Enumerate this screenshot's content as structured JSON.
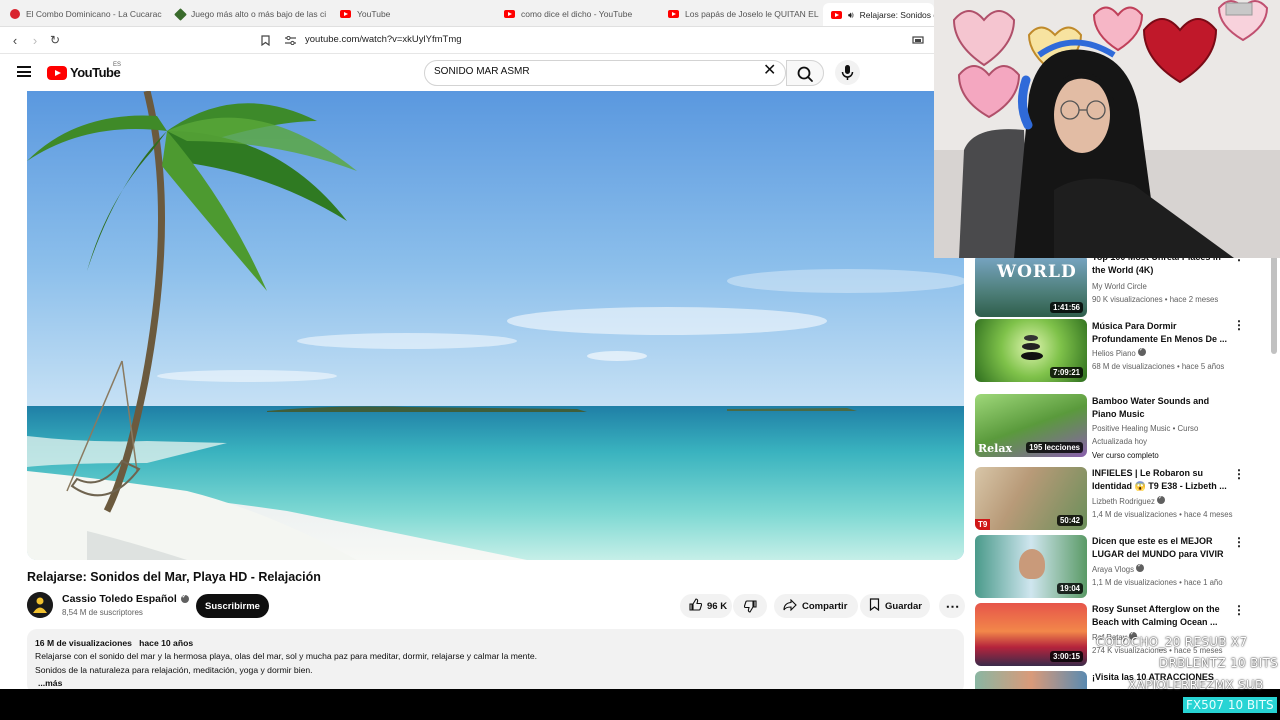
{
  "browser": {
    "tabs": [
      {
        "title": "El Combo Dominicano - La Cucaracha",
        "favicon": "youtube-icon"
      },
      {
        "title": "Juego más alto o más bajo de las cifras",
        "favicon": "game-icon"
      },
      {
        "title": "YouTube",
        "favicon": "youtube-icon"
      },
      {
        "title": "como dice el dicho - YouTube",
        "favicon": "youtube-icon"
      },
      {
        "title": "Los papás de Joselo le QUITAN EL DINERO",
        "favicon": "youtube-icon"
      },
      {
        "title": "Relajarse: Sonidos del Mar",
        "favicon": "youtube-icon",
        "active": true
      }
    ],
    "url": "youtube.com/watch?v=xkUylYfmTmg"
  },
  "youtube": {
    "logo_text": "YouTube",
    "country_code": "ES",
    "search_query": "SONIDO MAR ASMR",
    "brand_color": "#ff0000"
  },
  "video": {
    "title": "Relajarse: Sonidos del Mar, Playa HD - Relajación",
    "channel": "Cassio Toledo Español",
    "subscribers": "8,54 M de suscriptores",
    "subscribe_label": "Suscribirme",
    "likes": "96 K",
    "share_label": "Compartir",
    "save_label": "Guardar",
    "views": "16 M de visualizaciones",
    "age": "hace 10 años",
    "description": [
      "Relajarse con el sonido del mar y la hermosa playa, olas del mar, sol  y mucha paz para meditar, dormir, relajarse y calmar la mente.",
      "Sonidos de la naturaleza para relajación, meditación, yoga y dormir bien."
    ],
    "more_label": "...más"
  },
  "recommendations": [
    {
      "title": "Top 100 Most Unreal Places in the World (4K)",
      "channel": "My World Circle",
      "meta": "90 K visualizaciones • hace 2 meses",
      "duration": "1:41:56",
      "thumb_text": "WORLD"
    },
    {
      "title": "Música Para Dormir Profundamente En Menos De ...",
      "channel": "Helios Piano",
      "meta": "68 M de visualizaciones • hace 5 años",
      "duration": "7:09:21"
    },
    {
      "title": "Bamboo Water Sounds and Piano Music",
      "channel": "Positive Healing Music • Curso",
      "meta": "Actualizada hoy",
      "extra": "Ver curso completo",
      "duration": "195 lecciones",
      "thumb_text": "Relax"
    },
    {
      "title": "INFIELES | Le Robaron su Identidad 😱 T9 E38 - Lizbeth ...",
      "channel": "Lizbeth Rodriguez",
      "meta": "1,4 M de visualizaciones • hace 4 meses",
      "duration": "50:42",
      "thumb_text": "T9"
    },
    {
      "title": "Dicen que este es el MEJOR LUGAR del MUNDO para VIVIR",
      "channel": "Araya Vlogs",
      "meta": "1,1 M de visualizaciones • hace 1 año",
      "duration": "19:04"
    },
    {
      "title": "Rosy Sunset Afterglow on the Beach with Calming Ocean ...",
      "channel": "Raf Ratay",
      "meta": "274 K visualizaciones • hace 5 meses",
      "duration": "3:00:15"
    },
    {
      "title": "¡Visita las 10 ATRACCIONES",
      "channel": "",
      "meta": "",
      "duration": ""
    }
  ],
  "stream_overlay": {
    "lines": [
      "COLOCHO_20  RESUB X7",
      "DRBLENTZ  10 BITS",
      "XAPIOLERREZMX  SUB"
    ],
    "alert": "FX507  10 BITS",
    "alert_color": "#27d4d4"
  }
}
